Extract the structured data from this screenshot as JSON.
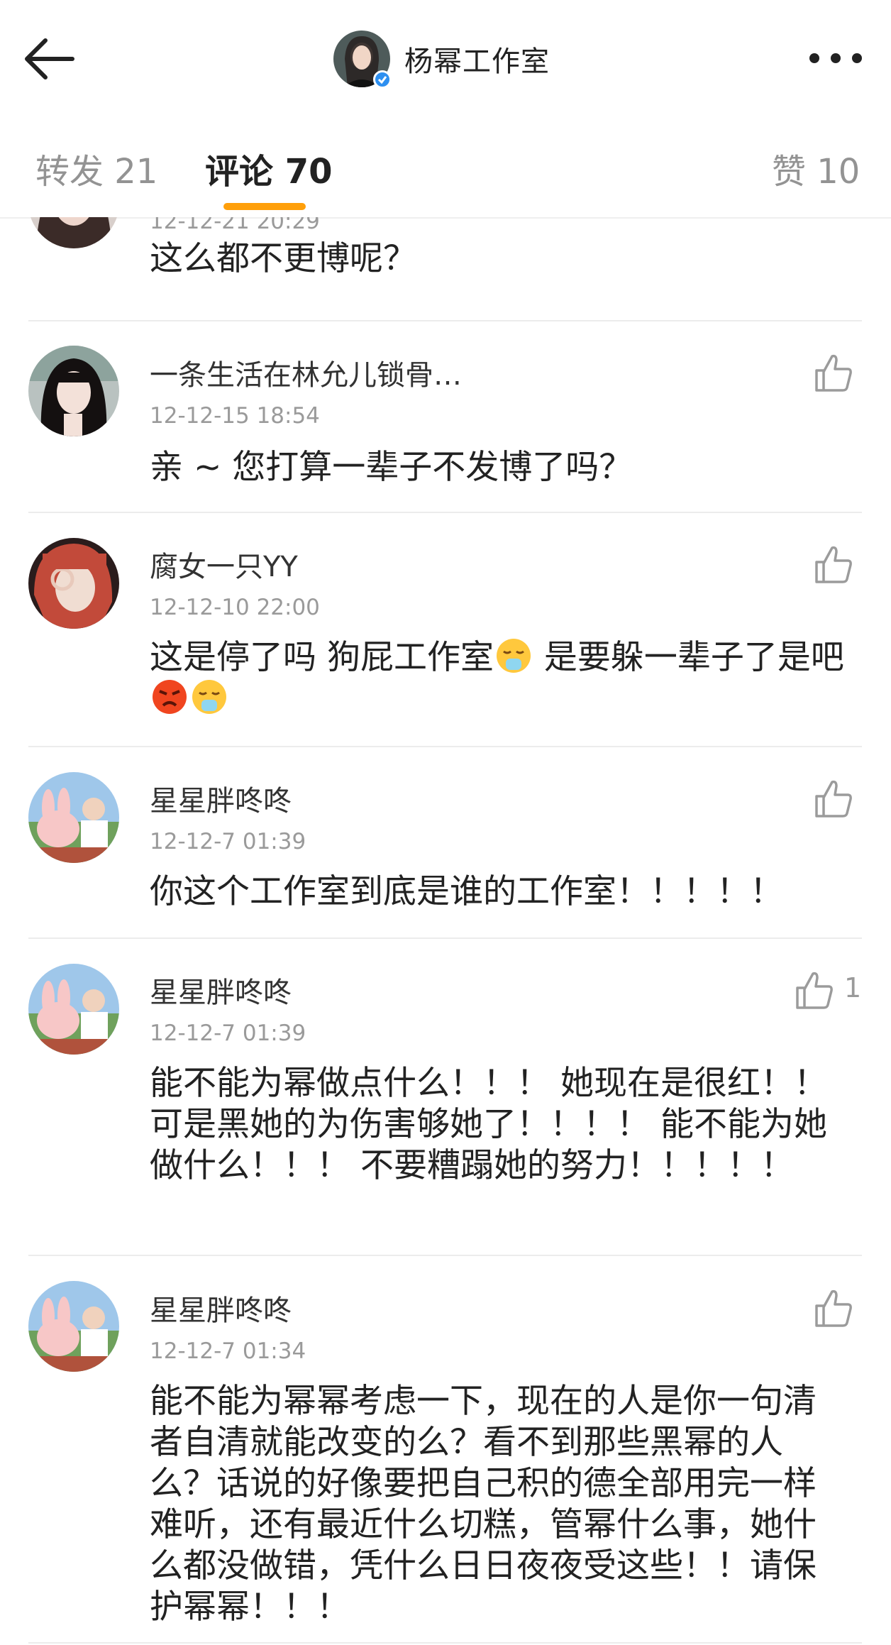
{
  "header": {
    "title": "杨幂工作室",
    "back_icon": "arrow-left-icon",
    "more_icon": "more-dots-icon"
  },
  "tabs": {
    "repost": "转发 21",
    "comment": "评论 70",
    "like": "赞 10",
    "accent": "#ff9f0a"
  },
  "comments": [
    {
      "time": "12-12-21 20:29",
      "text": "这么都不更博呢？"
    },
    {
      "name": "一条生活在林允儿锁骨…",
      "time": "12-12-15 18:54",
      "text": "亲 ~ 您打算一辈子不发博了吗？"
    },
    {
      "name": "腐女一只YY",
      "time": "12-12-10 22:00",
      "text_a": "这是停了吗 狗屁工作室",
      "text_b": " 是要躲一辈子了是吧"
    },
    {
      "name": "星星胖咚咚",
      "time": "12-12-7 01:39",
      "text": "你这个工作室到底是谁的工作室！！！！！"
    },
    {
      "name": "星星胖咚咚",
      "time": "12-12-7 01:39",
      "likes": "1",
      "text": "能不能为幂做点什么！！！ 她现在是很红！！ 可是黑她的为伤害够她了！！！！ 能不能为她做什么！！！ 不要糟蹋她的努力！！！！！"
    },
    {
      "name": "星星胖咚咚",
      "time": "12-12-7 01:34",
      "text": "能不能为幂幂考虑一下，现在的人是你一句清者自清就能改变的么？看不到那些黑幂的人么？话说的好像要把自己积的德全部用完一样难听，还有最近什么切糕，管幂什么事，她什么都没做错，凭什么日日夜夜受这些！！请保护幂幂！！！"
    }
  ]
}
